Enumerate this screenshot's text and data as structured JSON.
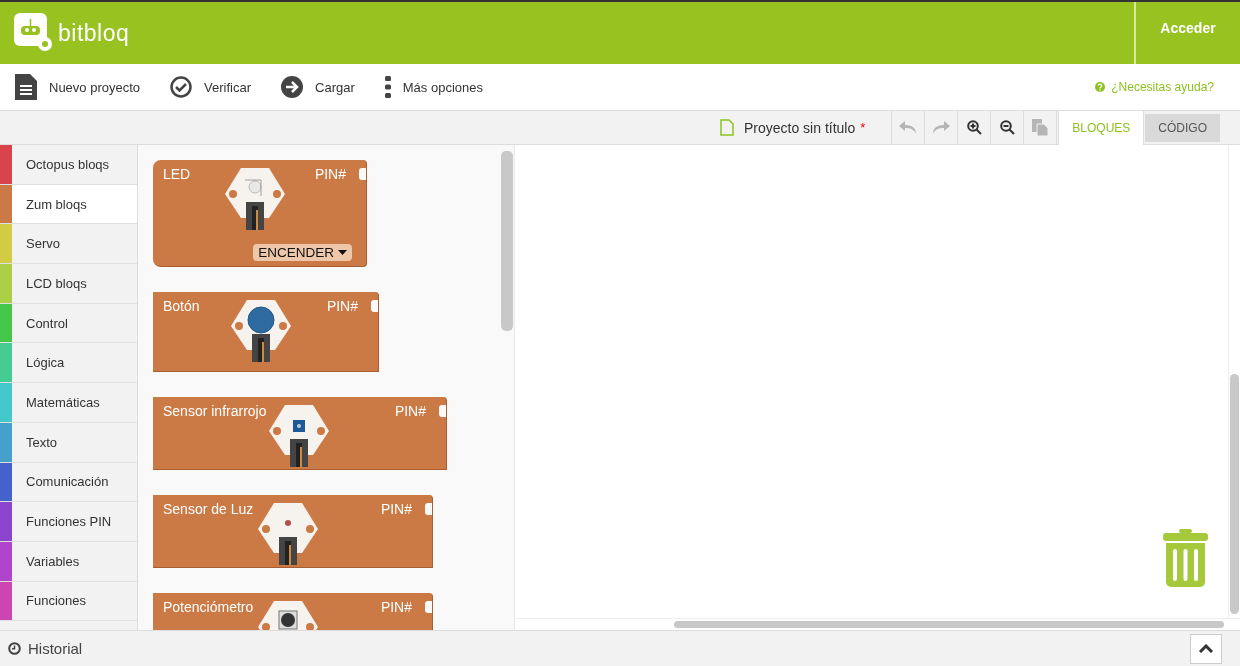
{
  "header": {
    "logo_text": "bitbloq",
    "login": "Acceder"
  },
  "toolbar": {
    "actions": [
      {
        "kind": "document",
        "label": "Nuevo proyecto"
      },
      {
        "kind": "check",
        "label": "Verificar"
      },
      {
        "kind": "arrow",
        "label": "Cargar"
      },
      {
        "kind": "dots",
        "label": "Más opciones"
      }
    ],
    "help": "¿Necesitas ayuda?"
  },
  "project": {
    "title": "Proyecto sin título",
    "unsaved_mark": "*",
    "tools": [
      {
        "kind": "undo",
        "disabled": true
      },
      {
        "kind": "redo",
        "disabled": true
      },
      {
        "kind": "zoom-in",
        "disabled": false
      },
      {
        "kind": "zoom-out",
        "disabled": false
      },
      {
        "kind": "paste",
        "disabled": true
      }
    ],
    "tabs": [
      {
        "label": "BLOQUES",
        "selected": true
      },
      {
        "label": "CÓDIGO",
        "selected": false
      }
    ]
  },
  "categories": [
    {
      "label": "Octopus bloqs",
      "color": "#d9434b",
      "selected": false
    },
    {
      "label": "Zum bloqs",
      "color": "#cc7a45",
      "selected": true
    },
    {
      "label": "Servo",
      "color": "#d2cc45",
      "selected": false
    },
    {
      "label": "LCD bloqs",
      "color": "#acd045",
      "selected": false
    },
    {
      "label": "Control",
      "color": "#45c84a",
      "selected": false
    },
    {
      "label": "Lógica",
      "color": "#45cc92",
      "selected": false
    },
    {
      "label": "Matemáticas",
      "color": "#45c8cc",
      "selected": false
    },
    {
      "label": "Texto",
      "color": "#45a0cc",
      "selected": false
    },
    {
      "label": "Comunicación",
      "color": "#4562cc",
      "selected": false
    },
    {
      "label": "Funciones PIN",
      "color": "#8a45cc",
      "selected": false
    },
    {
      "label": "Variables",
      "color": "#b045cc",
      "selected": false
    },
    {
      "label": "Funciones",
      "color": "#cc45b0",
      "selected": false
    }
  ],
  "blocks": [
    {
      "kind": "led",
      "name": "LED",
      "pin": "PIN#",
      "option": "ENCENDER"
    },
    {
      "kind": "button",
      "name": "Botón",
      "pin": "PIN#"
    },
    {
      "kind": "infrared",
      "name": "Sensor infrarrojo",
      "pin": "PIN#"
    },
    {
      "kind": "light",
      "name": "Sensor de Luz",
      "pin": "PIN#"
    },
    {
      "kind": "potentiometer",
      "name": "Potenciómetro",
      "pin": "PIN#"
    }
  ],
  "footer": {
    "label": "Historial"
  }
}
